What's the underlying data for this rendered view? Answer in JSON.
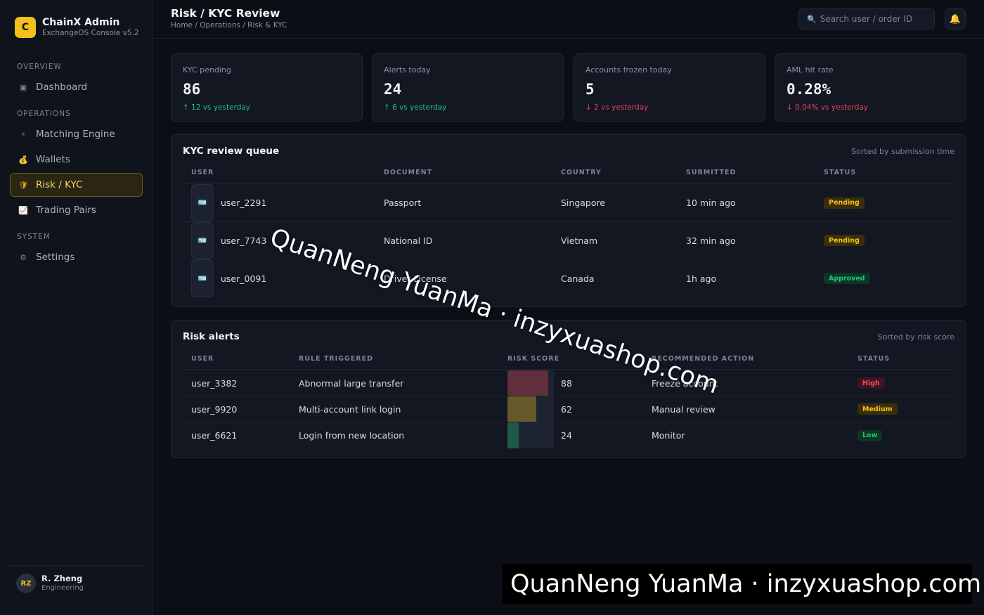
{
  "brand": {
    "logo_letter": "C",
    "title": "ChainX Admin",
    "subtitle": "ExchangeOS Console v5.2",
    "accent": "#f3c01c"
  },
  "nav": {
    "sections": {
      "overview": "OVERVIEW",
      "operations": "OPERATIONS",
      "system": "SYSTEM"
    },
    "items": [
      {
        "label": "Dashboard",
        "icon": "dashboard-icon",
        "glyph": "▣"
      },
      {
        "label": "Matching Engine",
        "icon": "lightning-icon",
        "glyph": "⚡"
      },
      {
        "label": "Wallets",
        "icon": "moneybag-icon",
        "glyph": "💰"
      },
      {
        "label": "Risk / KYC",
        "icon": "shield-icon",
        "glyph": "🛡",
        "active": true
      },
      {
        "label": "Trading Pairs",
        "icon": "chart-icon",
        "glyph": "📈"
      },
      {
        "label": "Settings",
        "icon": "gear-icon",
        "glyph": "⚙"
      }
    ]
  },
  "user": {
    "initials": "RZ",
    "name": "R. Zheng",
    "role": "Engineering"
  },
  "header": {
    "title": "Risk / KYC Review",
    "breadcrumb": "Home / Operations / Risk & KYC",
    "search_placeholder": "Search user / order ID"
  },
  "stats": [
    {
      "label": "KYC pending",
      "value": "86",
      "delta": "↑ 12 vs yesterday",
      "trend": "up"
    },
    {
      "label": "Alerts today",
      "value": "24",
      "delta": "↑ 6 vs yesterday",
      "trend": "up"
    },
    {
      "label": "Accounts frozen today",
      "value": "5",
      "delta": "↓ 2 vs yesterday",
      "trend": "down"
    },
    {
      "label": "AML hit rate",
      "value": "0.28%",
      "delta": "↓ 0.04% vs yesterday",
      "trend": "down"
    }
  ],
  "kyc": {
    "title": "KYC review queue",
    "note": "Sorted by submission time",
    "columns": [
      "USER",
      "DOCUMENT",
      "COUNTRY",
      "SUBMITTED",
      "STATUS"
    ],
    "rows": [
      {
        "user": "user_2291",
        "document": "Passport",
        "country": "Singapore",
        "submitted": "10 min ago",
        "status": "Pending"
      },
      {
        "user": "user_7743",
        "document": "National ID",
        "country": "Vietnam",
        "submitted": "32 min ago",
        "status": "Pending"
      },
      {
        "user": "user_0091",
        "document": "Driver License",
        "country": "Canada",
        "submitted": "1h ago",
        "status": "Approved"
      }
    ]
  },
  "alerts": {
    "title": "Risk alerts",
    "note": "Sorted by risk score",
    "columns": [
      "USER",
      "RULE TRIGGERED",
      "RISK SCORE",
      "RECOMMENDED ACTION",
      "STATUS"
    ],
    "rows": [
      {
        "user": "user_3382",
        "rule": "Abnormal large transfer",
        "score": "88",
        "action": "Freeze account",
        "status": "High"
      },
      {
        "user": "user_9920",
        "rule": "Multi-account link login",
        "score": "62",
        "action": "Manual review",
        "status": "Medium"
      },
      {
        "user": "user_6621",
        "rule": "Login from new location",
        "score": "24",
        "action": "Monitor",
        "status": "Low"
      }
    ]
  },
  "watermark": {
    "text": "QuanNeng YuanMa · inzyxuashop.com"
  }
}
